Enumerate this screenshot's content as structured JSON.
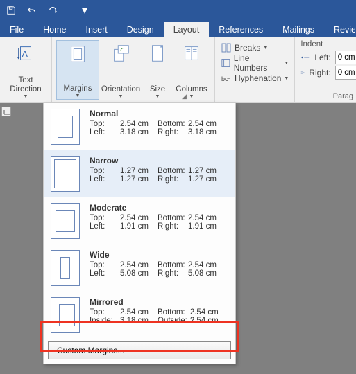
{
  "titlebar": {},
  "tabs": {
    "file": "File",
    "home": "Home",
    "insert": "Insert",
    "design": "Design",
    "layout": "Layout",
    "references": "References",
    "mailings": "Mailings",
    "review": "Revie"
  },
  "ribbon": {
    "textdirection": "Text\nDirection",
    "margins": "Margins",
    "orientation": "Orientation",
    "size": "Size",
    "columns": "Columns",
    "breaks": "Breaks",
    "linenumbers": "Line Numbers",
    "hyphenation": "Hyphenation",
    "indent": "Indent",
    "left": "Left:",
    "right": "Right:",
    "left_val": "0 cm",
    "right_val": "0 cm",
    "parag": "Parag"
  },
  "presets": [
    {
      "name": "Normal",
      "top": "2.54 cm",
      "bottom": "2.54 cm",
      "left": "3.18 cm",
      "right": "3.18 cm",
      "l1": "Top:",
      "l2": "Bottom:",
      "l3": "Left:",
      "l4": "Right:",
      "thumb": "normal"
    },
    {
      "name": "Narrow",
      "top": "1.27 cm",
      "bottom": "1.27 cm",
      "left": "1.27 cm",
      "right": "1.27 cm",
      "l1": "Top:",
      "l2": "Bottom:",
      "l3": "Left:",
      "l4": "Right:",
      "thumb": "narrow",
      "selected": true
    },
    {
      "name": "Moderate",
      "top": "2.54 cm",
      "bottom": "2.54 cm",
      "left": "1.91 cm",
      "right": "1.91 cm",
      "l1": "Top:",
      "l2": "Bottom:",
      "l3": "Left:",
      "l4": "Right:",
      "thumb": "moderate"
    },
    {
      "name": "Wide",
      "top": "2.54 cm",
      "bottom": "2.54 cm",
      "left": "5.08 cm",
      "right": "5.08 cm",
      "l1": "Top:",
      "l2": "Bottom:",
      "l3": "Left:",
      "l4": "Right:",
      "thumb": "wide"
    },
    {
      "name": "Mirrored",
      "top": "2.54 cm",
      "bottom": "2.54 cm",
      "left": "3.18 cm",
      "right": "2.54 cm",
      "l1": "Top:",
      "l2": "Bottom:",
      "l3": "Inside:",
      "l4": "Outside:",
      "thumb": "mirrored"
    }
  ],
  "custom_margins": "Custom Margins...",
  "colors": {
    "highlight": "#e32"
  }
}
